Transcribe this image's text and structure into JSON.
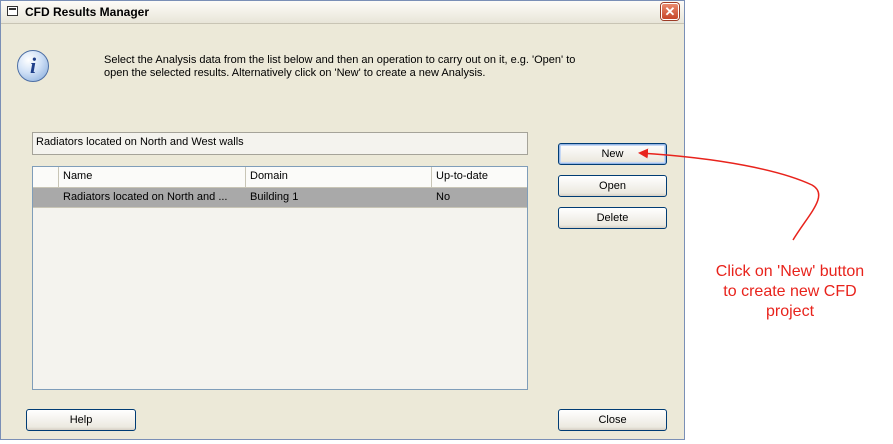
{
  "window": {
    "title": "CFD Results Manager",
    "close_glyph": "✕"
  },
  "info": {
    "icon": "info-icon",
    "text_line1": "Select the Analysis data from the list below and then an operation to carry out on it, e.g. 'Open' to",
    "text_line2": "open the selected results. Alternatively click on 'New' to create a new Analysis."
  },
  "selected_name": "Radiators located on North and West walls",
  "table": {
    "columns": [
      "Name",
      "Domain",
      "Up-to-date"
    ],
    "rows": [
      {
        "name": "Radiators located on North and ...",
        "domain": "Building 1",
        "uptodate": "No"
      }
    ]
  },
  "buttons": {
    "new": "New",
    "open": "Open",
    "delete": "Delete",
    "help": "Help",
    "close": "Close"
  },
  "annotation": {
    "line1": "Click on 'New' button",
    "line2": "to create new CFD",
    "line3": "project",
    "color": "#e8231c"
  }
}
